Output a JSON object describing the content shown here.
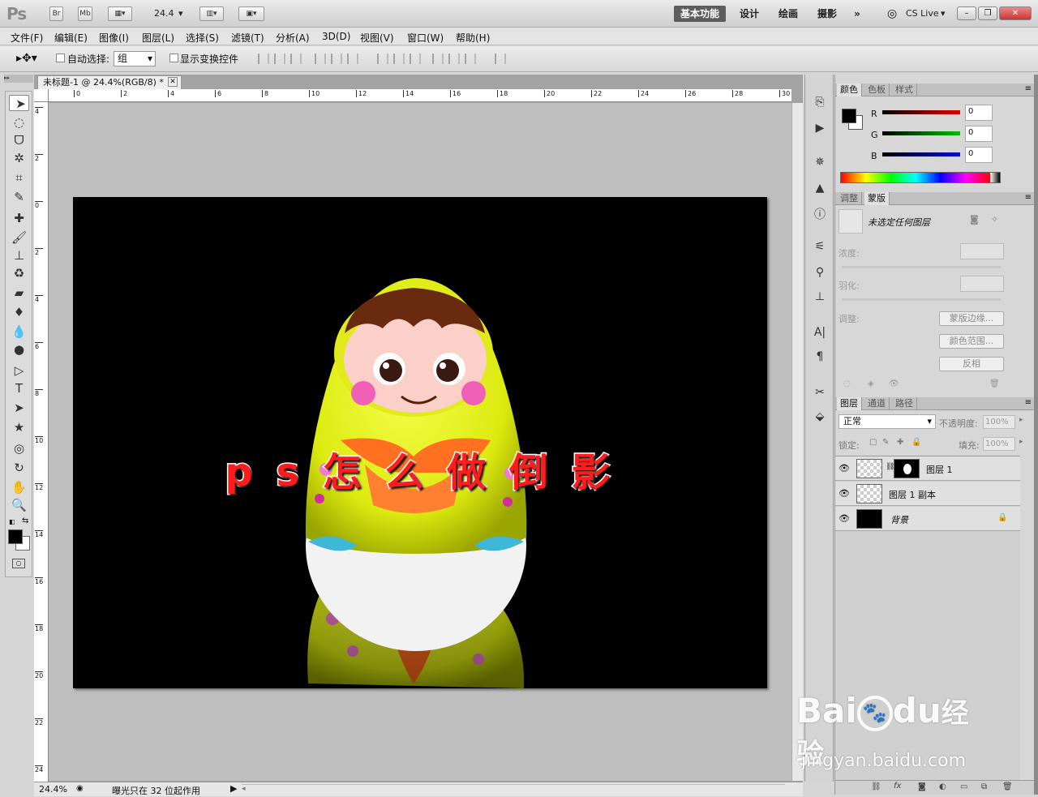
{
  "app": {
    "logo": "Ps",
    "bridge": "Br",
    "minibridge": "Mb",
    "zoom_value": "24.4",
    "workspaces": [
      "基本功能",
      "设计",
      "绘画",
      "摄影"
    ],
    "cs_live": "CS Live"
  },
  "menu": [
    "文件(F)",
    "编辑(E)",
    "图像(I)",
    "图层(L)",
    "选择(S)",
    "滤镜(T)",
    "分析(A)",
    "3D(D)",
    "视图(V)",
    "窗口(W)",
    "帮助(H)"
  ],
  "options": {
    "auto_select": "自动选择:",
    "auto_select_value": "组",
    "show_transform": "显示变换控件"
  },
  "document": {
    "tab_title": "未标题-1 @ 24.4%(RGB/8) *",
    "ruler_h_labels": [
      "0",
      "2",
      "4",
      "6",
      "8",
      "10",
      "12",
      "14",
      "16",
      "18",
      "20",
      "22",
      "24",
      "26",
      "28",
      "30"
    ],
    "ruler_v_labels": [
      "4",
      "2",
      "0",
      "2",
      "4",
      "6",
      "8",
      "10",
      "12",
      "14",
      "16",
      "18",
      "20",
      "22",
      "24"
    ],
    "overlay_text": "p s 怎 么 做 倒 影",
    "canvas_bg": "#000000",
    "status_zoom": "24.4%",
    "status_text": "曝光只在 32 位起作用"
  },
  "color_panel": {
    "tabs": [
      "颜色",
      "色板",
      "样式"
    ],
    "channels": [
      {
        "label": "R",
        "value": "0",
        "color": "#e00000"
      },
      {
        "label": "G",
        "value": "0",
        "color": "#00b800"
      },
      {
        "label": "B",
        "value": "0",
        "color": "#0010d0"
      }
    ]
  },
  "mask_panel": {
    "tabs": [
      "调整",
      "蒙版"
    ],
    "no_mask": "未选定任何图层",
    "density": "浓度:",
    "feather": "羽化:",
    "refine": "调整:",
    "btn_edge": "蒙版边缘...",
    "btn_range": "颜色范围...",
    "btn_invert": "反相"
  },
  "layers_panel": {
    "tabs": [
      "图层",
      "通道",
      "路径"
    ],
    "blend_mode": "正常",
    "opacity_label": "不透明度:",
    "opacity_value": "100%",
    "lock_label": "锁定:",
    "fill_label": "填充:",
    "fill_value": "100%",
    "layers": [
      {
        "name": "图层 1"
      },
      {
        "name": "图层 1 副本"
      },
      {
        "name": "背景"
      }
    ]
  },
  "watermark": {
    "brand": "Bai",
    "brand2": "du",
    "cn": "经验",
    "url": "jingyan.baidu.com"
  }
}
